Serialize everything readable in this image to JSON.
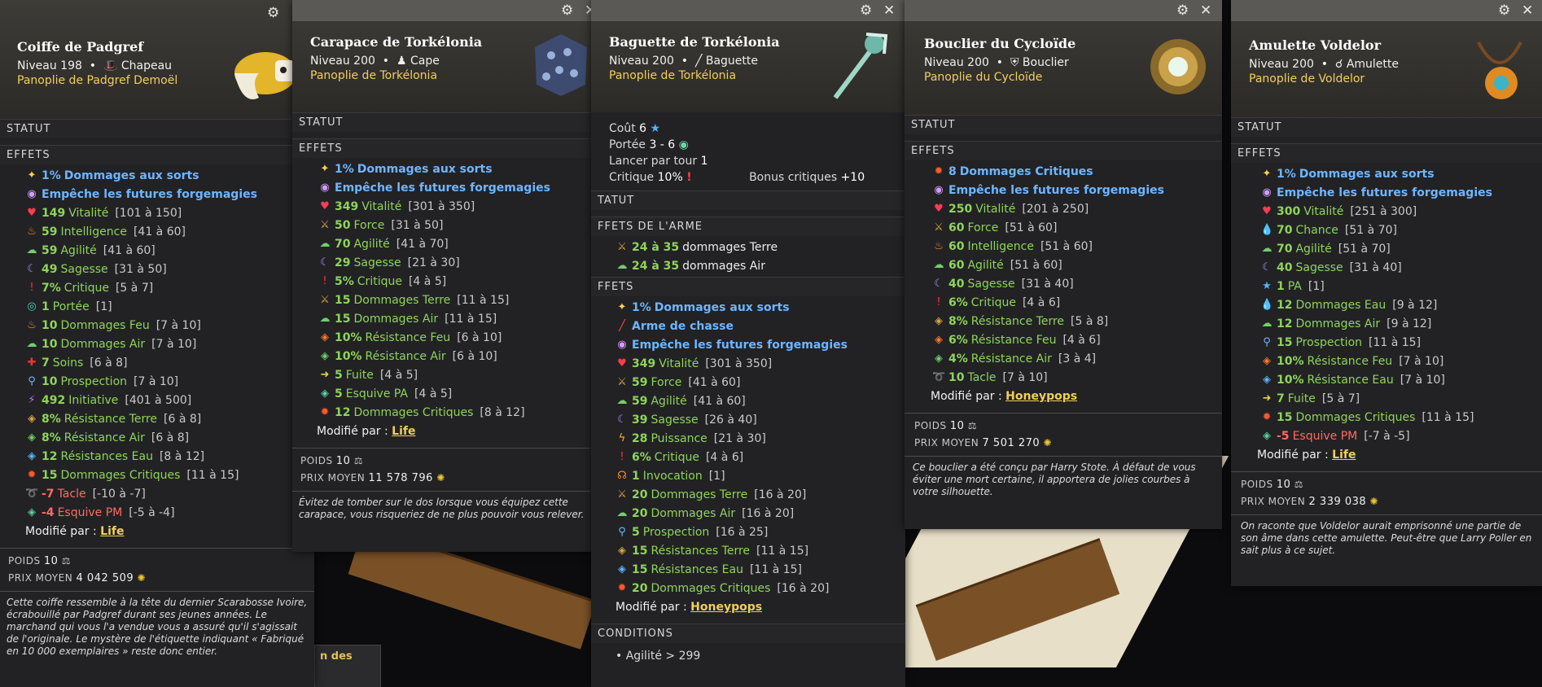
{
  "icons": {
    "damage": "✦",
    "forge": "◉",
    "vita": "♥",
    "fire": "♨",
    "agi": "☁",
    "wis": "☾",
    "crit": "!",
    "range": "◎",
    "heal": "✚",
    "pros": "⚲",
    "init": "⚡",
    "res_earth": "◈",
    "res_air": "◈",
    "res_water": "◈",
    "res_fire": "◈",
    "critdmg": "✹",
    "tackle": "➰",
    "dodge": "◈",
    "str": "⚔",
    "flee": "➜",
    "ap": "★",
    "water": "💧",
    "pow": "ϟ",
    "inv": "☊",
    "hunt": "╱",
    "star": "★",
    "eye": "◉",
    "gear": "⚙",
    "close": "✕",
    "weight": "⚖",
    "coin": "✺"
  },
  "colors": {
    "panel": "#222225",
    "header": "#3b3a36",
    "set": "#f3cf5d",
    "green": "#8fd45a",
    "blue": "#6eb6ff",
    "red": "#ff6b60"
  },
  "items": [
    {
      "name": "Coiffe de Padgref",
      "level": "Niveau 198",
      "type": "Chapeau",
      "set": "Panoplie de Padgref Demoël",
      "status_label": "STATUT",
      "effects_label": "EFFETS",
      "effects": [
        {
          "icon": "damage",
          "v": "1%",
          "n": "Dommages aux sorts",
          "r": "",
          "style": "blue"
        },
        {
          "icon": "forge",
          "v": "",
          "n": "Empêche les futures forgemagies",
          "r": "",
          "style": "blue"
        },
        {
          "icon": "vita",
          "v": "149",
          "n": "Vitalité",
          "r": "[101 à 150]",
          "style": ""
        },
        {
          "icon": "fire",
          "v": "59",
          "n": "Intelligence",
          "r": "[41 à 60]",
          "style": ""
        },
        {
          "icon": "agi",
          "v": "59",
          "n": "Agilité",
          "r": "[41 à 60]",
          "style": ""
        },
        {
          "icon": "wis",
          "v": "49",
          "n": "Sagesse",
          "r": "[31 à 50]",
          "style": ""
        },
        {
          "icon": "crit",
          "v": "7%",
          "n": "Critique",
          "r": "[5 à 7]",
          "style": ""
        },
        {
          "icon": "range",
          "v": "1",
          "n": "Portée",
          "r": "[1]",
          "style": ""
        },
        {
          "icon": "fire",
          "v": "10",
          "n": "Dommages Feu",
          "r": "[7 à 10]",
          "style": ""
        },
        {
          "icon": "agi",
          "v": "10",
          "n": "Dommages Air",
          "r": "[7 à 10]",
          "style": ""
        },
        {
          "icon": "heal",
          "v": "7",
          "n": "Soins",
          "r": "[6 à 8]",
          "style": ""
        },
        {
          "icon": "pros",
          "v": "10",
          "n": "Prospection",
          "r": "[7 à 10]",
          "style": ""
        },
        {
          "icon": "init",
          "v": "492",
          "n": "Initiative",
          "r": "[401 à 500]",
          "style": ""
        },
        {
          "icon": "res_earth",
          "v": "8%",
          "n": "Résistance Terre",
          "r": "[6 à 8]",
          "style": ""
        },
        {
          "icon": "res_air",
          "v": "8%",
          "n": "Résistance Air",
          "r": "[6 à 8]",
          "style": ""
        },
        {
          "icon": "res_water",
          "v": "12",
          "n": "Résistances Eau",
          "r": "[8 à 12]",
          "style": ""
        },
        {
          "icon": "critdmg",
          "v": "15",
          "n": "Dommages Critiques",
          "r": "[11 à 15]",
          "style": ""
        },
        {
          "icon": "tackle",
          "v": "-7",
          "n": "Tacle",
          "r": "[-10 à -7]",
          "style": "red"
        },
        {
          "icon": "dodge",
          "v": "-4",
          "n": "Esquive PM",
          "r": "[-5 à -4]",
          "style": "red"
        }
      ],
      "modified_label": "Modifié par :",
      "modified_by": "Life",
      "weight_label": "POIDS",
      "weight": "10",
      "price_label": "PRIX MOYEN",
      "price": "4 042 509",
      "description": "Cette coiffe ressemble à la tête du dernier Scarabosse Ivoire, écrabouillé par Padgref durant ses jeunes années. Le marchand qui vous l'a vendue vous a assuré qu'il s'agissait de l'originale. Le mystère de l'étiquette indiquant « Fabriqué en 10 000 exemplaires » reste donc entier."
    },
    {
      "name": "Carapace de Torkélonia",
      "level": "Niveau 200",
      "type": "Cape",
      "set": "Panoplie de Torkélonia",
      "status_label": "STATUT",
      "effects_label": "EFFETS",
      "effects": [
        {
          "icon": "damage",
          "v": "1%",
          "n": "Dommages aux sorts",
          "r": "",
          "style": "blue"
        },
        {
          "icon": "forge",
          "v": "",
          "n": "Empêche les futures forgemagies",
          "r": "",
          "style": "blue"
        },
        {
          "icon": "vita",
          "v": "349",
          "n": "Vitalité",
          "r": "[301 à 350]",
          "style": ""
        },
        {
          "icon": "str",
          "v": "50",
          "n": "Force",
          "r": "[31 à 50]",
          "style": ""
        },
        {
          "icon": "agi",
          "v": "70",
          "n": "Agilité",
          "r": "[41 à 70]",
          "style": ""
        },
        {
          "icon": "wis",
          "v": "29",
          "n": "Sagesse",
          "r": "[21 à 30]",
          "style": ""
        },
        {
          "icon": "crit",
          "v": "5%",
          "n": "Critique",
          "r": "[4 à 5]",
          "style": ""
        },
        {
          "icon": "str",
          "v": "15",
          "n": "Dommages Terre",
          "r": "[11 à 15]",
          "style": ""
        },
        {
          "icon": "agi",
          "v": "15",
          "n": "Dommages Air",
          "r": "[11 à 15]",
          "style": ""
        },
        {
          "icon": "res_fire",
          "v": "10%",
          "n": "Résistance Feu",
          "r": "[6 à 10]",
          "style": ""
        },
        {
          "icon": "res_air",
          "v": "10%",
          "n": "Résistance Air",
          "r": "[6 à 10]",
          "style": ""
        },
        {
          "icon": "flee",
          "v": "5",
          "n": "Fuite",
          "r": "[4 à 5]",
          "style": ""
        },
        {
          "icon": "dodge",
          "v": "5",
          "n": "Esquive PA",
          "r": "[4 à 5]",
          "style": ""
        },
        {
          "icon": "critdmg",
          "v": "12",
          "n": "Dommages Critiques",
          "r": "[8 à 12]",
          "style": ""
        }
      ],
      "modified_label": "Modifié par :",
      "modified_by": "Life",
      "weight_label": "POIDS",
      "weight": "10",
      "price_label": "PRIX MOYEN",
      "price": "11 578 796",
      "description": "Évitez de tomber sur le dos lorsque vous équipez cette carapace, vous risqueriez de ne plus pouvoir vous relever."
    },
    {
      "name": "Baguette de Torkélonia",
      "level": "Niveau 200",
      "type": "Baguette",
      "set": "Panoplie de Torkélonia",
      "cost_label": "Coût",
      "cost": "6",
      "range_label": "Portée",
      "range": "3 - 6",
      "perturn_label": "Lancer par tour",
      "perturn": "1",
      "crit_label": "Critique",
      "crit": "10%",
      "critbonus_label": "Bonus critiques",
      "critbonus": "+10",
      "status_label": "TATUT",
      "weapon_label": "FFETS DE L'ARME",
      "weapon": [
        {
          "icon": "str",
          "v": "24 à 35",
          "n": "dommages Terre",
          "r": "",
          "style": "white"
        },
        {
          "icon": "agi",
          "v": "24 à 35",
          "n": "dommages Air",
          "r": "",
          "style": "white"
        }
      ],
      "effects_label": "FFETS",
      "effects": [
        {
          "icon": "damage",
          "v": "1%",
          "n": "Dommages aux sorts",
          "r": "",
          "style": "blue"
        },
        {
          "icon": "hunt",
          "v": "",
          "n": "Arme de chasse",
          "r": "",
          "style": "blue"
        },
        {
          "icon": "forge",
          "v": "",
          "n": "Empêche les futures forgemagies",
          "r": "",
          "style": "blue"
        },
        {
          "icon": "vita",
          "v": "349",
          "n": "Vitalité",
          "r": "[301 à 350]",
          "style": ""
        },
        {
          "icon": "str",
          "v": "59",
          "n": "Force",
          "r": "[41 à 60]",
          "style": ""
        },
        {
          "icon": "agi",
          "v": "59",
          "n": "Agilité",
          "r": "[41 à 60]",
          "style": ""
        },
        {
          "icon": "wis",
          "v": "39",
          "n": "Sagesse",
          "r": "[26 à 40]",
          "style": ""
        },
        {
          "icon": "pow",
          "v": "28",
          "n": "Puissance",
          "r": "[21 à 30]",
          "style": ""
        },
        {
          "icon": "crit",
          "v": "6%",
          "n": "Critique",
          "r": "[4 à 6]",
          "style": ""
        },
        {
          "icon": "inv",
          "v": "1",
          "n": "Invocation",
          "r": "[1]",
          "style": ""
        },
        {
          "icon": "str",
          "v": "20",
          "n": "Dommages Terre",
          "r": "[16 à 20]",
          "style": ""
        },
        {
          "icon": "agi",
          "v": "20",
          "n": "Dommages Air",
          "r": "[16 à 20]",
          "style": ""
        },
        {
          "icon": "pros",
          "v": "5",
          "n": "Prospection",
          "r": "[16 à 25]",
          "style": ""
        },
        {
          "icon": "res_earth",
          "v": "15",
          "n": "Résistances Terre",
          "r": "[11 à 15]",
          "style": ""
        },
        {
          "icon": "res_water",
          "v": "15",
          "n": "Résistances Eau",
          "r": "[11 à 15]",
          "style": ""
        },
        {
          "icon": "critdmg",
          "v": "20",
          "n": "Dommages Critiques",
          "r": "[16 à 20]",
          "style": ""
        }
      ],
      "modified_label": "Modifié par :",
      "modified_by": "Honeypops",
      "conditions_label": "CONDITIONS",
      "condition": "• Agilité > 299"
    },
    {
      "name": "Bouclier du Cycloïde",
      "level": "Niveau 200",
      "type": "Bouclier",
      "set": "Panoplie du Cycloïde",
      "status_label": "STATUT",
      "effects_label": "EFFETS",
      "effects": [
        {
          "icon": "critdmg",
          "v": "8",
          "n": "Dommages Critiques",
          "r": "",
          "style": "blue"
        },
        {
          "icon": "forge",
          "v": "",
          "n": "Empêche les futures forgemagies",
          "r": "",
          "style": "blue"
        },
        {
          "icon": "vita",
          "v": "250",
          "n": "Vitalité",
          "r": "[201 à 250]",
          "style": ""
        },
        {
          "icon": "str",
          "v": "60",
          "n": "Force",
          "r": "[51 à 60]",
          "style": ""
        },
        {
          "icon": "fire",
          "v": "60",
          "n": "Intelligence",
          "r": "[51 à 60]",
          "style": ""
        },
        {
          "icon": "agi",
          "v": "60",
          "n": "Agilité",
          "r": "[51 à 60]",
          "style": ""
        },
        {
          "icon": "wis",
          "v": "40",
          "n": "Sagesse",
          "r": "[31 à 40]",
          "style": ""
        },
        {
          "icon": "crit",
          "v": "6%",
          "n": "Critique",
          "r": "[4 à 6]",
          "style": ""
        },
        {
          "icon": "res_earth",
          "v": "8%",
          "n": "Résistance Terre",
          "r": "[5 à 8]",
          "style": ""
        },
        {
          "icon": "res_fire",
          "v": "6%",
          "n": "Résistance Feu",
          "r": "[4 à 6]",
          "style": ""
        },
        {
          "icon": "res_air",
          "v": "4%",
          "n": "Résistance Air",
          "r": "[3 à 4]",
          "style": ""
        },
        {
          "icon": "tackle",
          "v": "10",
          "n": "Tacle",
          "r": "[7 à 10]",
          "style": ""
        }
      ],
      "modified_label": "Modifié par :",
      "modified_by": "Honeypops",
      "weight_label": "POIDS",
      "weight": "10",
      "price_label": "PRIX MOYEN",
      "price": "7 501 270",
      "description": "Ce bouclier a été conçu par Harry Stote. À défaut de vous éviter une mort certaine, il apportera de jolies courbes à votre silhouette."
    },
    {
      "name": "Amulette Voldelor",
      "level": "Niveau 200",
      "type": "Amulette",
      "set": "Panoplie de Voldelor",
      "status_label": "STATUT",
      "effects_label": "EFFETS",
      "effects": [
        {
          "icon": "damage",
          "v": "1%",
          "n": "Dommages aux sorts",
          "r": "",
          "style": "blue"
        },
        {
          "icon": "forge",
          "v": "",
          "n": "Empêche les futures forgemagies",
          "r": "",
          "style": "blue"
        },
        {
          "icon": "vita",
          "v": "300",
          "n": "Vitalité",
          "r": "[251 à 300]",
          "style": ""
        },
        {
          "icon": "water",
          "v": "70",
          "n": "Chance",
          "r": "[51 à 70]",
          "style": ""
        },
        {
          "icon": "agi",
          "v": "70",
          "n": "Agilité",
          "r": "[51 à 70]",
          "style": ""
        },
        {
          "icon": "wis",
          "v": "40",
          "n": "Sagesse",
          "r": "[31 à 40]",
          "style": ""
        },
        {
          "icon": "ap",
          "v": "1",
          "n": "PA",
          "r": "[1]",
          "style": ""
        },
        {
          "icon": "water",
          "v": "12",
          "n": "Dommages Eau",
          "r": "[9 à 12]",
          "style": ""
        },
        {
          "icon": "agi",
          "v": "12",
          "n": "Dommages Air",
          "r": "[9 à 12]",
          "style": ""
        },
        {
          "icon": "pros",
          "v": "15",
          "n": "Prospection",
          "r": "[11 à 15]",
          "style": ""
        },
        {
          "icon": "res_fire",
          "v": "10%",
          "n": "Résistance Feu",
          "r": "[7 à 10]",
          "style": ""
        },
        {
          "icon": "res_water",
          "v": "10%",
          "n": "Résistance Eau",
          "r": "[7 à 10]",
          "style": ""
        },
        {
          "icon": "flee",
          "v": "7",
          "n": "Fuite",
          "r": "[5 à 7]",
          "style": ""
        },
        {
          "icon": "critdmg",
          "v": "15",
          "n": "Dommages Critiques",
          "r": "[11 à 15]",
          "style": ""
        },
        {
          "icon": "dodge",
          "v": "-5",
          "n": "Esquive PM",
          "r": "[-7 à -5]",
          "style": "red"
        }
      ],
      "modified_label": "Modifié par :",
      "modified_by": "Life",
      "weight_label": "POIDS",
      "weight": "10",
      "price_label": "PRIX MOYEN",
      "price": "2 339 038",
      "description": "On raconte que Voldelor aurait emprisonné une partie de son âme dans cette amulette. Peut-être que Larry Poller en sait plus à ce sujet."
    }
  ],
  "background": {
    "box_text": "n des"
  }
}
